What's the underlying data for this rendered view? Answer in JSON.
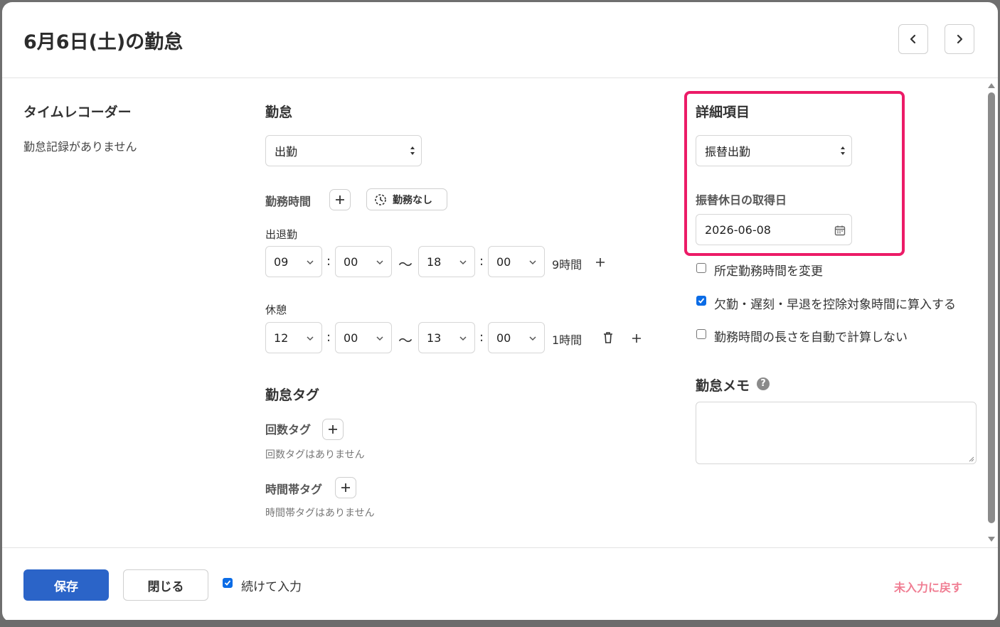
{
  "dialog": {
    "title": "6月6日(土)の勤怠",
    "prev_icon": "chevron-left-icon",
    "next_icon": "chevron-right-icon"
  },
  "time_recorder": {
    "heading": "タイムレコーダー",
    "empty_text": "勤怠記録がありません"
  },
  "attendance": {
    "heading": "勤怠",
    "type_value": "出勤",
    "work_time_label": "勤務時間",
    "no_work_label": "勤務なし",
    "clock_label": "出退勤",
    "clock": {
      "start_h": "09",
      "start_m": "00",
      "end_h": "18",
      "end_m": "00",
      "duration": "9時間"
    },
    "break_label": "休憩",
    "break": {
      "start_h": "12",
      "start_m": "00",
      "end_h": "13",
      "end_m": "00",
      "duration": "1時間"
    },
    "colon": ":",
    "tilde": "〜"
  },
  "tags": {
    "heading": "勤怠タグ",
    "count_tag_label": "回数タグ",
    "count_tag_empty": "回数タグはありません",
    "time_tag_label": "時間帯タグ",
    "time_tag_empty": "時間帯タグはありません"
  },
  "details": {
    "heading": "詳細項目",
    "type_value": "振替出勤",
    "holiday_label": "振替休日の取得日",
    "holiday_date": "2026-06-08",
    "checkboxes": [
      {
        "label": "所定勤務時間を変更",
        "checked": false
      },
      {
        "label": "欠勤・遅刻・早退を控除対象時間に算入する",
        "checked": true
      },
      {
        "label": "勤務時間の長さを自動で計算しない",
        "checked": false
      }
    ],
    "memo_heading": "勤怠メモ",
    "memo_value": "",
    "help_glyph": "?",
    "highlight_color": "#ec1b67"
  },
  "footer": {
    "save_label": "保存",
    "close_label": "閉じる",
    "continue_label": "続けて入力",
    "continue_checked": true,
    "reset_label": "未入力に戻す",
    "primary_color": "#2b64c8",
    "reset_color": "#f07e93"
  }
}
